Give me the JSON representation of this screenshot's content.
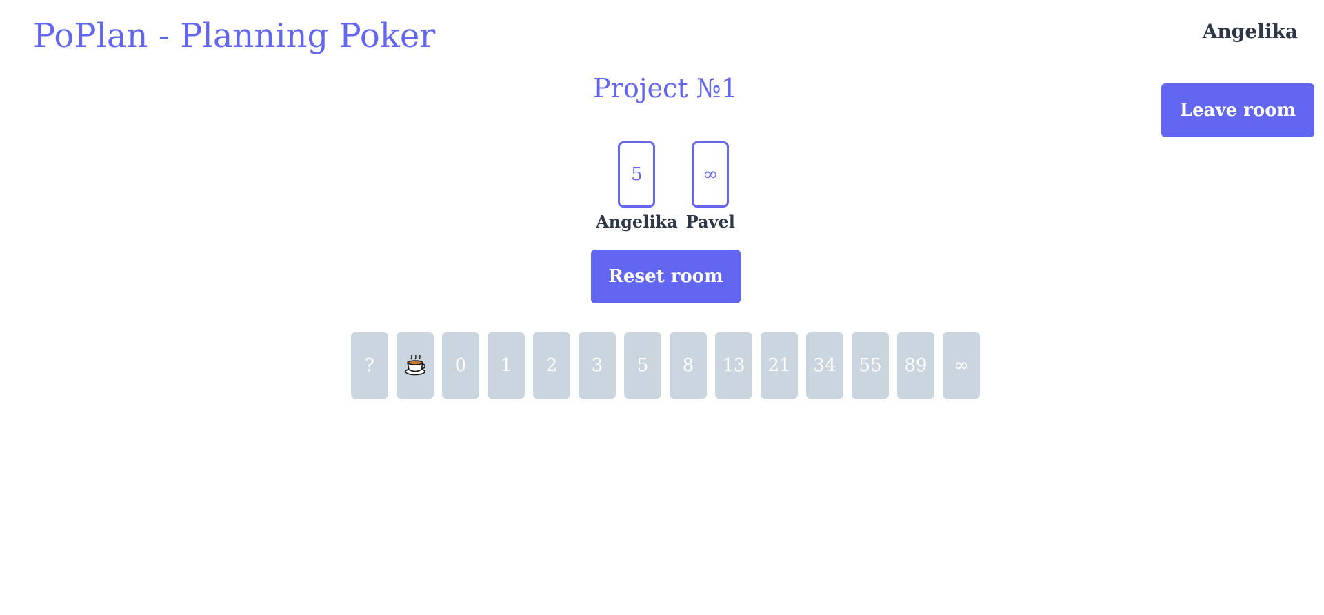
{
  "header": {
    "app_title": "PoPlan - Planning Poker",
    "user_name": "Angelika",
    "leave_label": "Leave room"
  },
  "room": {
    "project_title": "Project №1",
    "players": [
      {
        "name": "Angelika",
        "vote": "5"
      },
      {
        "name": "Pavel",
        "vote": "∞"
      }
    ],
    "reset_label": "Reset room"
  },
  "deck": {
    "cards": [
      "?",
      "coffee-icon",
      "0",
      "1",
      "2",
      "3",
      "5",
      "8",
      "13",
      "21",
      "34",
      "55",
      "89",
      "∞"
    ]
  },
  "colors": {
    "accent": "#6366f1",
    "text_dark": "#2d3748",
    "card_gray": "#cbd5e0"
  }
}
